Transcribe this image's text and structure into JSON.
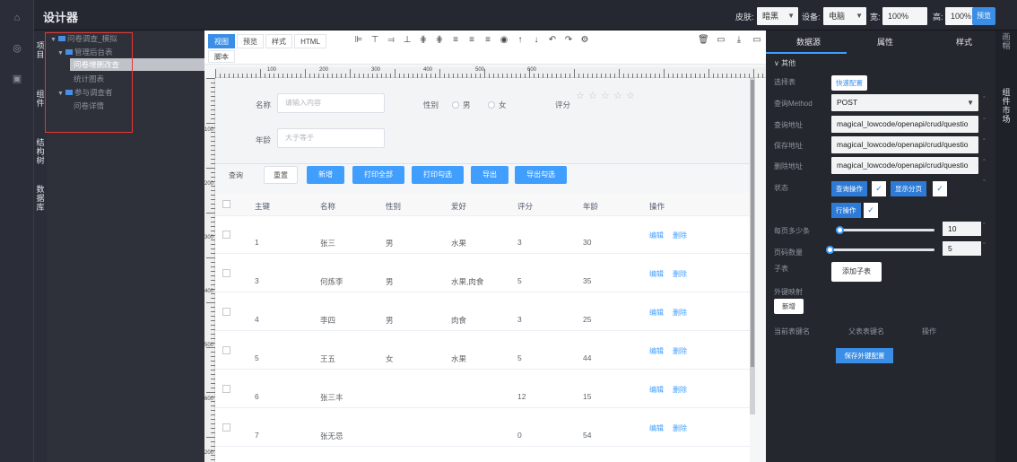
{
  "app": {
    "title": "设计器"
  },
  "topbar": {
    "skin_label": "皮肤:",
    "skin_value": "暗黑",
    "device_label": "设备:",
    "device_value": "电脑",
    "width_label": "宽:",
    "width_value": "100%",
    "height_label": "高:",
    "height_value": "100%",
    "preview_label": "预览"
  },
  "nav_icons": [
    "home-icon",
    "globe-icon",
    "briefcase-icon"
  ],
  "sidetabs": {
    "project": "项目",
    "components": "组件",
    "structure": "结构树",
    "database": "数据库"
  },
  "tree": [
    {
      "label": "问卷调查_模拟",
      "level": 0,
      "expanded": true,
      "folder": true
    },
    {
      "label": "管理后台表",
      "level": 1,
      "expanded": true,
      "folder": true
    },
    {
      "label": "问卷增删改查",
      "level": 2,
      "selected": true
    },
    {
      "label": "统计图表",
      "level": 2
    },
    {
      "label": "参与调查者",
      "level": 1,
      "expanded": true,
      "folder": true
    },
    {
      "label": "问卷详情",
      "level": 2
    }
  ],
  "canvas": {
    "tabs": [
      "视图",
      "预览",
      "样式",
      "HTML"
    ],
    "active_tab": "视图",
    "script_tab": "脚本",
    "ruler_numbers": [
      "100",
      "200",
      "300",
      "400",
      "500",
      "600"
    ],
    "vruler_numbers": [
      "100",
      "200",
      "300",
      "400",
      "500",
      "600",
      "200"
    ]
  },
  "form": {
    "name_label": "名称",
    "name_placeholder": "请输入内容",
    "gender_label": "性别",
    "gender_options": [
      "男",
      "女"
    ],
    "rating_label": "评分",
    "age_label": "年龄",
    "age_placeholder": "大于等于"
  },
  "actions": {
    "query": "查询",
    "reset": "重置",
    "add": "新增",
    "print_all": "打印全部",
    "print_selected": "打印勾选",
    "export": "导出",
    "export_selected": "导出勾选"
  },
  "table": {
    "headers": [
      "主键",
      "名称",
      "性别",
      "爱好",
      "评分",
      "年龄",
      "操作"
    ],
    "edit": "编辑",
    "delete": "删除",
    "rows": [
      [
        "1",
        "张三",
        "男",
        "水果",
        "3",
        "30"
      ],
      [
        "3",
        "何炼李",
        "男",
        "水果,肉食",
        "5",
        "35"
      ],
      [
        "4",
        "李四",
        "男",
        "肉食",
        "3",
        "25"
      ],
      [
        "5",
        "王五",
        "女",
        "水果",
        "5",
        "44"
      ],
      [
        "6",
        "张三丰",
        "",
        "",
        "12",
        "15"
      ],
      [
        "7",
        "张无忌",
        "",
        "",
        "0",
        "54"
      ]
    ]
  },
  "rpanel": {
    "tabs": [
      "数据源",
      "属性",
      "样式"
    ],
    "section": "其他",
    "select_table_label": "选择表",
    "quick_config": "快速配置",
    "method_label": "查询Method",
    "method_value": "POST",
    "query_url_label": "查询地址",
    "query_url": "magical_lowcode/openapi/crud/questio",
    "save_url_label": "保存地址",
    "save_url": "magical_lowcode/openapi/crud/questio",
    "delete_url_label": "删除地址",
    "delete_url": "magical_lowcode/openapi/crud/questio",
    "status_label": "状态",
    "query_op": "查询操作",
    "show_paging": "显示分页",
    "row_op": "行操作",
    "page_size_label": "每页多少条",
    "page_size": "10",
    "page_count_label": "页码数量",
    "page_count": "5",
    "subtable_label": "子表",
    "add_subtable": "添加子表",
    "fk_label": "外键映射",
    "fk_add": "新增",
    "fk_cols": [
      "当前表键名",
      "父表表键名",
      "操作"
    ],
    "save_fk": "保存外键配置"
  },
  "rcol": {
    "market": "组件市场",
    "top": "画帽"
  }
}
